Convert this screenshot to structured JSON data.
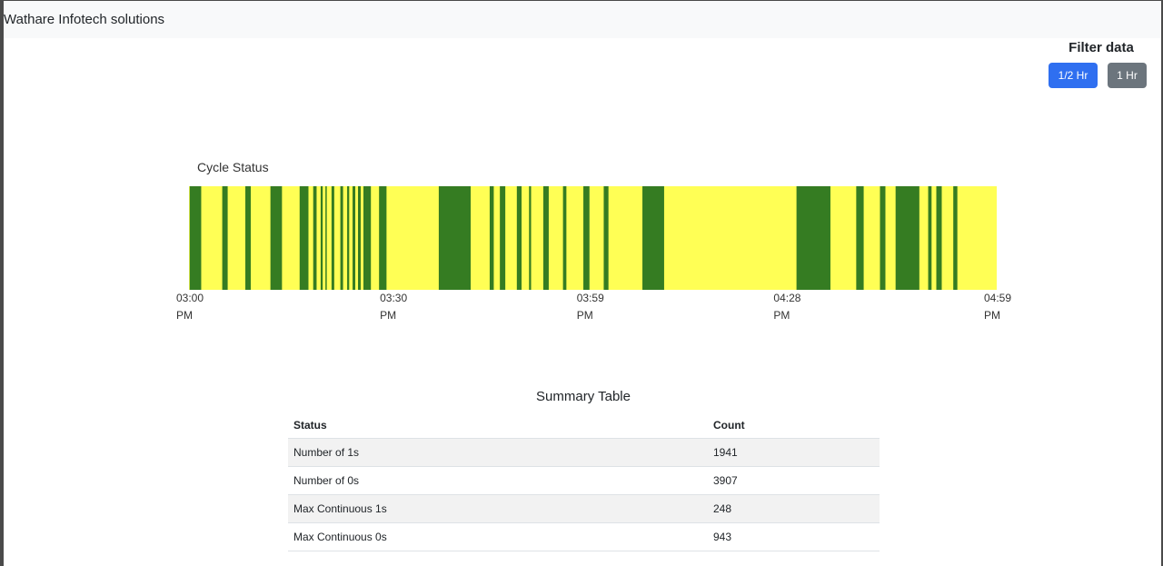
{
  "navbar": {
    "brand": "Wathare Infotech solutions"
  },
  "filter": {
    "title": "Filter data",
    "buttons": [
      {
        "label": "1/2 Hr",
        "color": "#2f6ff0"
      },
      {
        "label": "1 Hr",
        "color": "#6c757d"
      }
    ]
  },
  "colors": {
    "status_1": "#357c22",
    "status_0": "#ffff55"
  },
  "chart_data": {
    "type": "bar",
    "title": "Cycle Status",
    "x_ticks": [
      {
        "time": "03:00",
        "ampm": "PM"
      },
      {
        "time": "03:30",
        "ampm": "PM"
      },
      {
        "time": "03:59",
        "ampm": "PM"
      },
      {
        "time": "04:28",
        "ampm": "PM"
      },
      {
        "time": "04:59",
        "ampm": "PM"
      }
    ],
    "x_range_minutes": [
      0,
      119
    ],
    "tick_minutes": [
      0,
      30,
      59,
      88,
      119
    ],
    "status_1_intervals_minutes": [
      [
        0.1,
        1.8
      ],
      [
        4.9,
        5.7
      ],
      [
        8.3,
        9.1
      ],
      [
        12.0,
        13.7
      ],
      [
        16.3,
        17.6
      ],
      [
        18.3,
        18.8
      ],
      [
        19.4,
        19.7
      ],
      [
        20.1,
        20.3
      ],
      [
        21.0,
        21.4
      ],
      [
        22.3,
        22.7
      ],
      [
        23.3,
        23.6
      ],
      [
        24.1,
        24.5
      ],
      [
        24.9,
        25.3
      ],
      [
        25.7,
        26.8
      ],
      [
        28.0,
        29.1
      ],
      [
        36.8,
        41.5
      ],
      [
        44.3,
        44.9
      ],
      [
        45.8,
        46.6
      ],
      [
        48.3,
        49.0
      ],
      [
        50.1,
        50.4
      ],
      [
        52.2,
        53.0
      ],
      [
        55.1,
        55.6
      ],
      [
        58.1,
        59.0
      ],
      [
        61.1,
        61.8
      ],
      [
        66.8,
        70.0
      ],
      [
        89.5,
        94.5
      ],
      [
        98.3,
        99.4
      ],
      [
        101.8,
        102.6
      ],
      [
        104.1,
        107.6
      ],
      [
        108.9,
        109.4
      ],
      [
        110.1,
        110.9
      ],
      [
        112.6,
        113.2
      ]
    ]
  },
  "summary": {
    "title": "Summary Table",
    "headers": {
      "status": "Status",
      "count": "Count"
    },
    "rows": [
      {
        "status": "Number of 1s",
        "count": "1941"
      },
      {
        "status": "Number of 0s",
        "count": "3907"
      },
      {
        "status": "Max Continuous 1s",
        "count": "248"
      },
      {
        "status": "Max Continuous 0s",
        "count": "943"
      }
    ]
  }
}
